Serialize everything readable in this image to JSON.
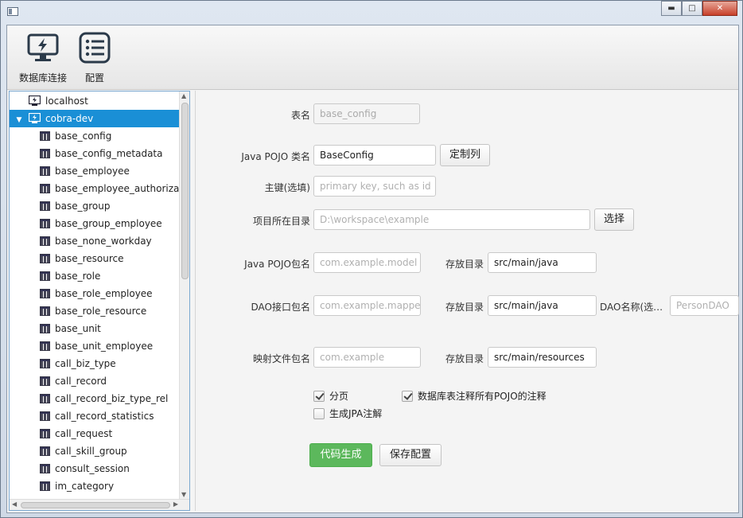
{
  "window": {
    "minimize": "▬",
    "maximize": "□",
    "close": "✕"
  },
  "toolbar": {
    "db_connect_label": "数据库连接",
    "config_label": "配置"
  },
  "tree": {
    "connections": [
      {
        "label": "localhost"
      },
      {
        "label": "cobra-dev"
      }
    ],
    "tables": [
      "base_config",
      "base_config_metadata",
      "base_employee",
      "base_employee_authorizat",
      "base_group",
      "base_group_employee",
      "base_none_workday",
      "base_resource",
      "base_role",
      "base_role_employee",
      "base_role_resource",
      "base_unit",
      "base_unit_employee",
      "call_biz_type",
      "call_record",
      "call_record_biz_type_rel",
      "call_record_statistics",
      "call_request",
      "call_skill_group",
      "consult_session",
      "im_category"
    ]
  },
  "form": {
    "table_name_label": "表名",
    "table_name_value": "base_config",
    "pojo_class_label": "Java POJO 类名",
    "pojo_class_value": "BaseConfig",
    "custom_columns_button": "定制列",
    "primary_key_label": "主键(选填)",
    "primary_key_placeholder": "primary key, such as id",
    "project_dir_label": "项目所在目录",
    "project_dir_placeholder": "D:\\workspace\\example",
    "choose_button": "选择",
    "pojo_package_label": "Java POJO包名",
    "pojo_package_placeholder": "com.example.model",
    "save_dir_label": "存放目录",
    "pojo_dir_value": "src/main/java",
    "dao_package_label": "DAO接口包名",
    "dao_package_placeholder": "com.example.mapper",
    "dao_dir_value": "src/main/java",
    "dao_name_label": "DAO名称(选…",
    "dao_name_placeholder": "PersonDAO",
    "mapper_package_label": "映射文件包名",
    "mapper_package_placeholder": "com.example",
    "mapper_dir_value": "src/main/resources",
    "paging_label": "分页",
    "comment_label": "数据库表注释所有POJO的注释",
    "jpa_label": "生成JPA注解",
    "generate_button": "代码生成",
    "save_config_button": "保存配置"
  },
  "options": {
    "paging": true,
    "comment": true,
    "jpa": false
  },
  "colors": {
    "selection": "#1a8fd6",
    "generate": "#5cb85c"
  }
}
